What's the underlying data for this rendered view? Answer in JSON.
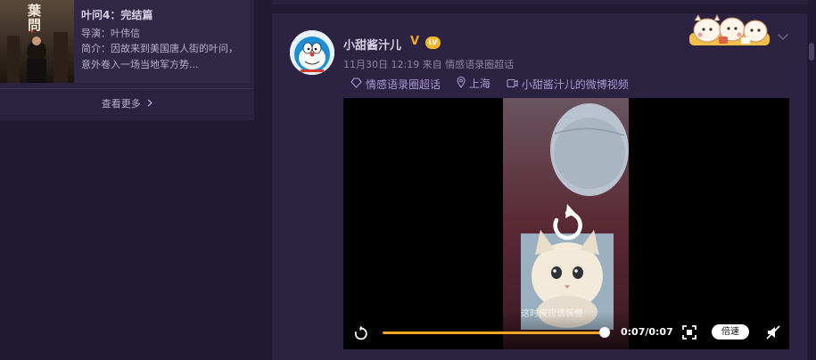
{
  "movie": {
    "title": "叶问4：完结篇",
    "director": "导演：叶伟信",
    "description": "简介：因故来到美国唐人街的叶问，意外卷入一场当地军方势...",
    "more_label": "查看更多",
    "poster_text": "葉問"
  },
  "post": {
    "user_name": "小甜酱汁儿",
    "verified_mark": "V",
    "level_badge": "LV",
    "time_source": "11月30日 12:19 来自 情感语录圈超话",
    "tags": [
      {
        "icon": "topic-icon",
        "label": "情感语录圈超话"
      },
      {
        "icon": "location-icon",
        "label": "上海"
      },
      {
        "icon": "video-icon",
        "label": "小甜酱汁儿的微博视频"
      }
    ]
  },
  "video": {
    "caption": "这时候应该装傻",
    "time": "0:07/0:07",
    "speed_label": "倍速",
    "progress": 1.0
  },
  "colors": {
    "accent": "#f5a623",
    "tag_text": "#a99ad1",
    "card_bg": "#2c2242",
    "page_bg": "#221933"
  }
}
